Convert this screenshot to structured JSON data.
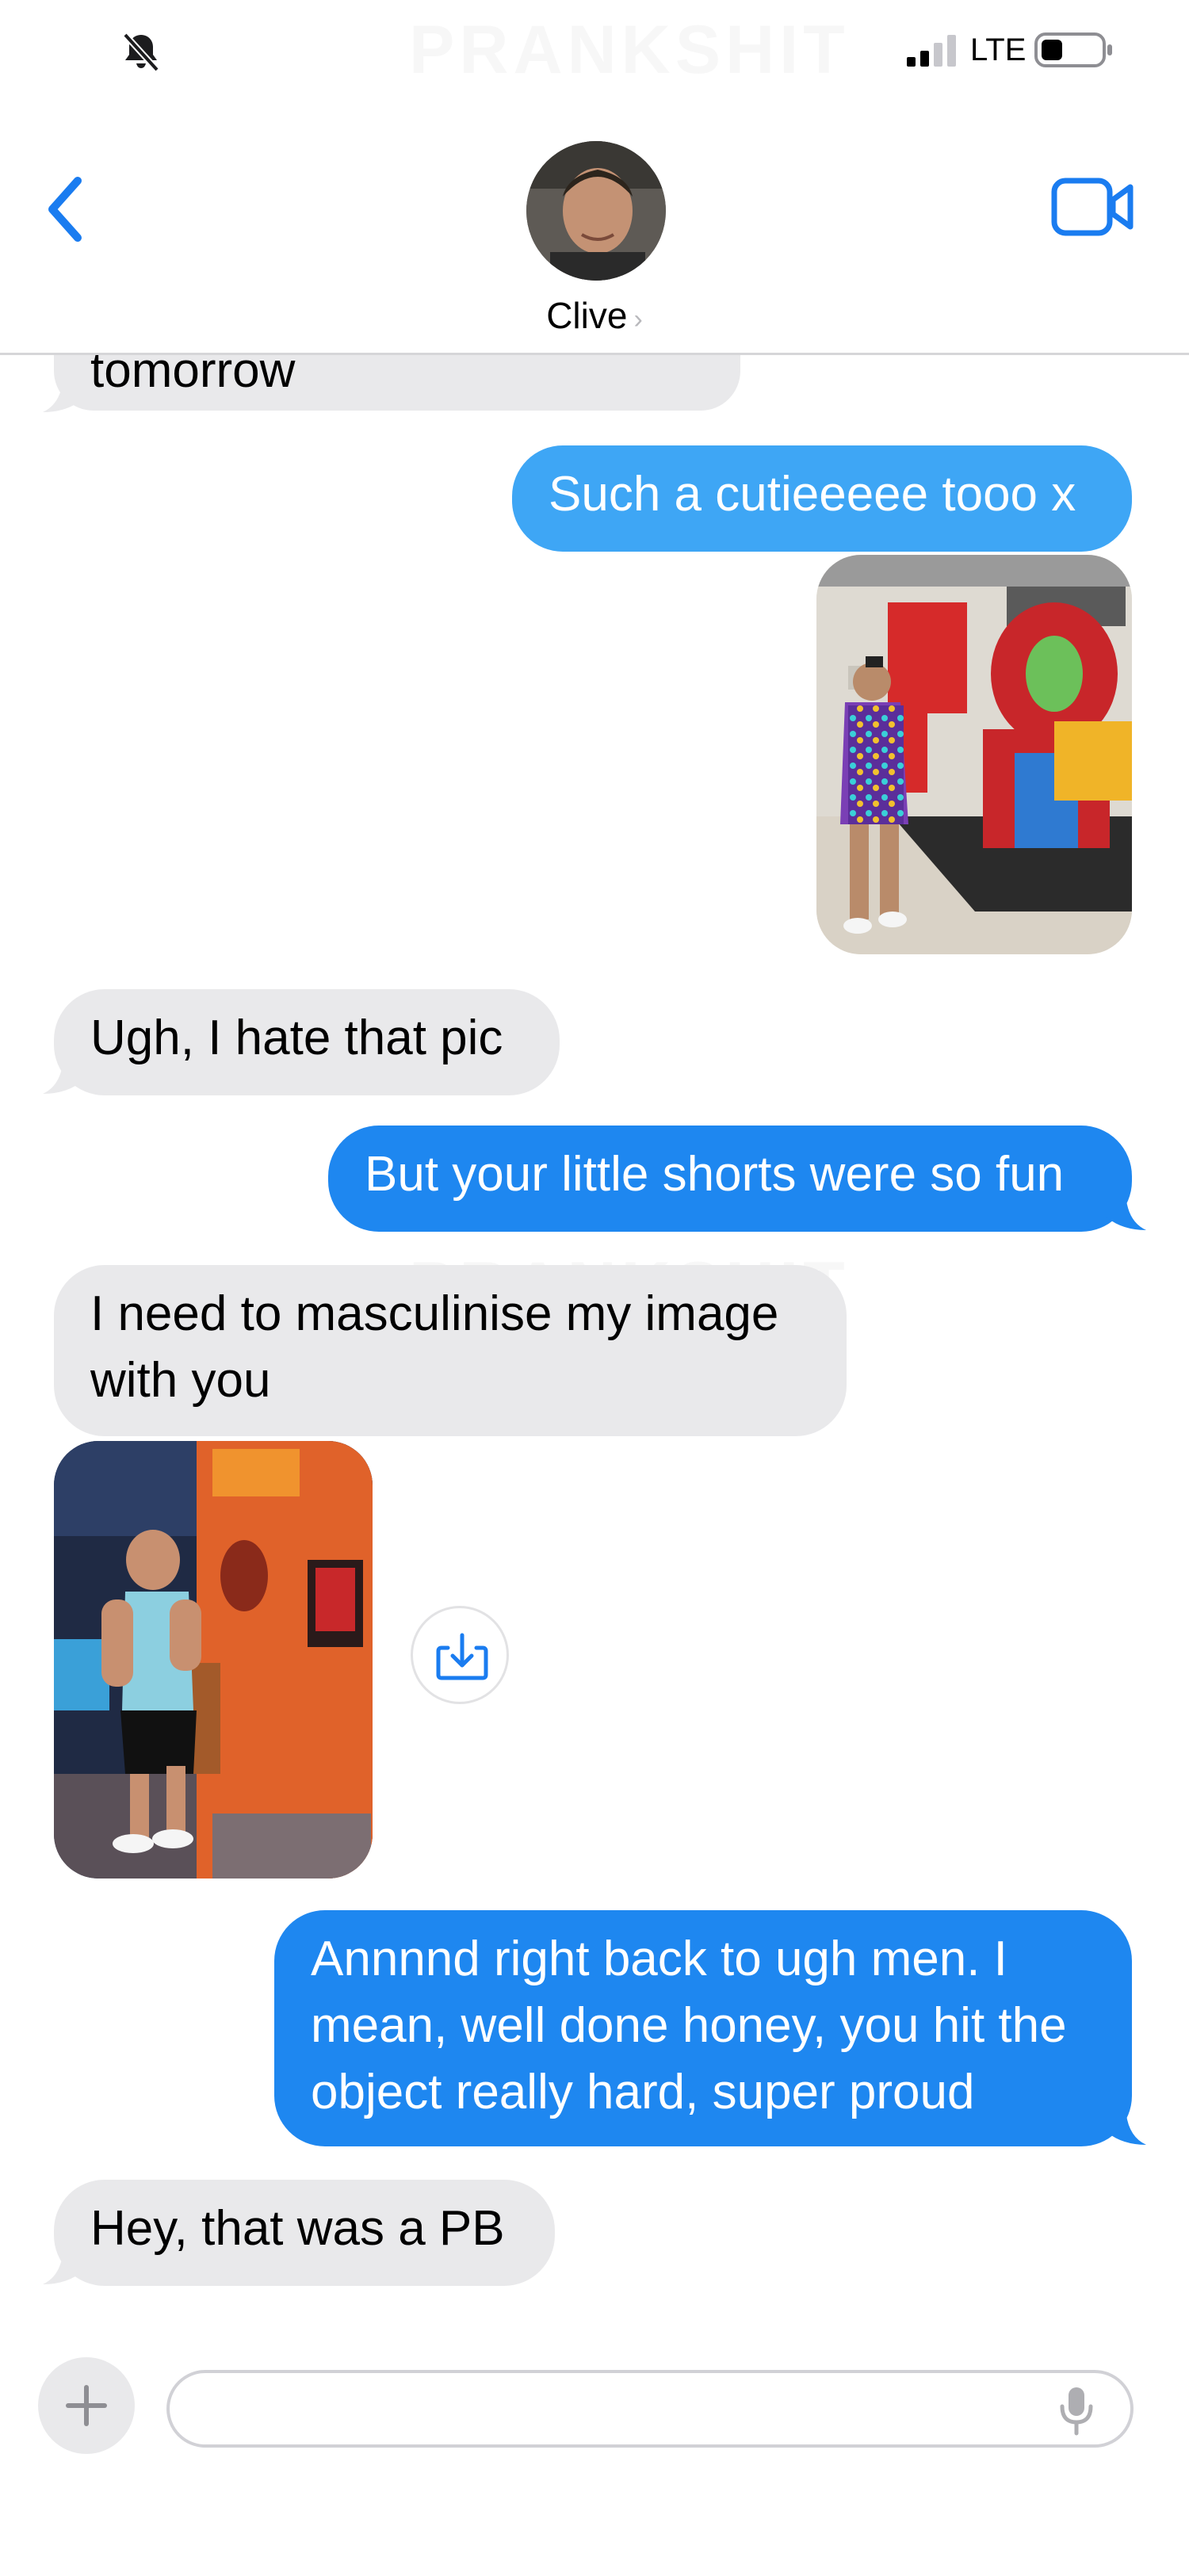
{
  "watermark": "PRANKSHIT",
  "status_bar": {
    "network": "LTE",
    "silent_icon": "bell-slash-icon",
    "signal_icon": "signal-bars-icon",
    "battery_icon": "battery-icon"
  },
  "header": {
    "contact_name": "Clive",
    "chevron": "›",
    "back_icon": "chevron-left-icon",
    "video_icon": "video-camera-icon"
  },
  "colors": {
    "accent": "#1a7cf0",
    "outgoing_bubble": "#3ea6f5",
    "outgoing_bubble_deep": "#1e87f0",
    "incoming_bubble": "#e9e9eb"
  },
  "messages": [
    {
      "direction": "in",
      "text": "tomorrow"
    },
    {
      "direction": "out",
      "text": "Such a cutieeeee tooo x"
    },
    {
      "direction": "out",
      "type": "photo",
      "description_icon": "photo-icon"
    },
    {
      "direction": "in",
      "text": "Ugh, I hate that pic"
    },
    {
      "direction": "out",
      "text": "But your little shorts were so fun"
    },
    {
      "direction": "in",
      "lines": [
        "I need to masculinise my image",
        "with you"
      ]
    },
    {
      "direction": "in",
      "type": "video",
      "description_icon": "video-thumbnail-icon"
    },
    {
      "direction": "out",
      "lines": [
        "Annnnd right back to ugh men. I",
        "mean, well done honey, you hit the",
        "object really hard, super proud"
      ]
    },
    {
      "direction": "in",
      "text": "Hey, that was a PB"
    }
  ],
  "composer": {
    "plus_icon": "plus-icon",
    "mic_icon": "microphone-icon",
    "field_value": ""
  }
}
